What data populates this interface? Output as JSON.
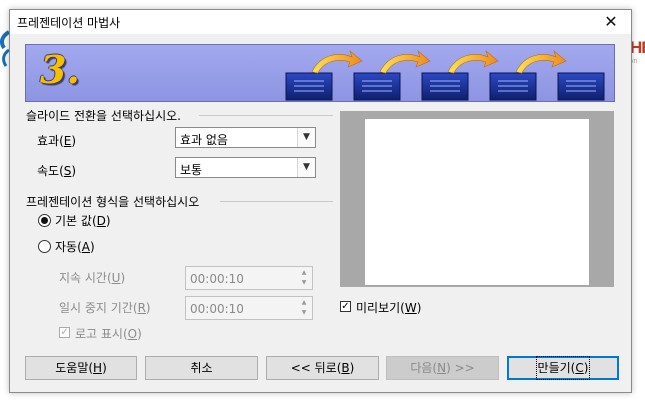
{
  "window": {
    "title": "프레젠테이션 마법사",
    "close_glyph": "✕"
  },
  "banner": {
    "step": "3.",
    "colors": {
      "bg": "#9aa0ea",
      "arrow": "#f4a51c",
      "slide": "#1a2f8a"
    }
  },
  "transition_section": {
    "heading": "슬라이드 전환을 선택하십시오.",
    "effect": {
      "label": "효과",
      "hotkey": "E",
      "value": "효과 없음"
    },
    "speed": {
      "label": "속도",
      "hotkey": "S",
      "value": "보통"
    }
  },
  "format_section": {
    "heading": "프레젠테이션 형식을 선택하십시오",
    "default_option": {
      "label": "기본 값",
      "hotkey": "D",
      "selected": true
    },
    "auto_option": {
      "label": "자동",
      "hotkey": "A",
      "selected": false
    },
    "duration": {
      "label": "지속 시간",
      "hotkey": "U",
      "value": "00:00:10"
    },
    "pause": {
      "label": "일시 중지 기간",
      "hotkey": "R",
      "value": "00:00:10"
    },
    "show_logo": {
      "label": "로고 표시",
      "hotkey": "O",
      "checked": true
    }
  },
  "preview": {
    "label": "미리보기",
    "hotkey": "W",
    "checked": true
  },
  "buttons": {
    "help": {
      "label": "도움말",
      "hotkey": "H"
    },
    "cancel": {
      "label": "취소"
    },
    "back": {
      "label": "<< 뒤로",
      "hotkey": "B"
    },
    "next": {
      "label": "다음",
      "hotkey": "N",
      "suffix": ">>"
    },
    "create": {
      "label": "만들기",
      "hotkey": "C"
    }
  },
  "background": {
    "right_text": "HE",
    "right_sub": "ATI"
  },
  "glyphs": {
    "dropdown": "▼",
    "spin_up": "▲",
    "spin_down": "▼",
    "check": "✓"
  }
}
